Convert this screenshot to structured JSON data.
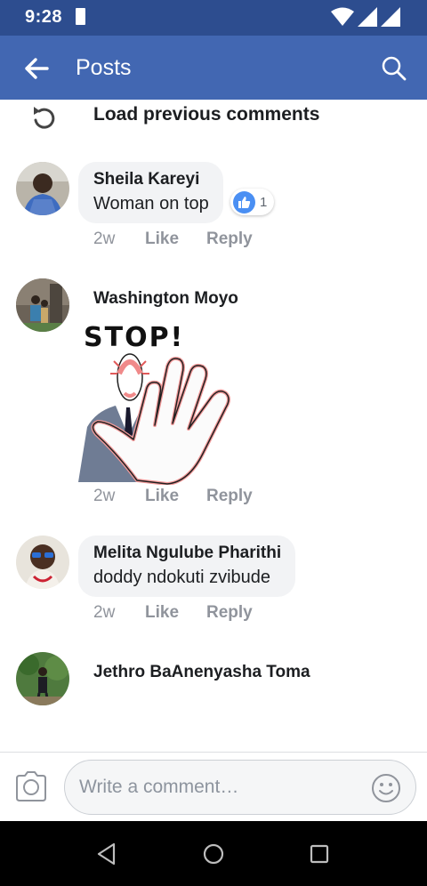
{
  "status_bar": {
    "time": "9:28"
  },
  "header": {
    "title": "Posts"
  },
  "load_previous": {
    "label": "Load previous comments"
  },
  "comments": [
    {
      "author": "Sheila Kareyi",
      "text": "Woman on top",
      "reaction_count": "1",
      "time": "2w",
      "like": "Like",
      "reply": "Reply"
    },
    {
      "author": "Washington Moyo",
      "sticker_text": "STOP!",
      "time": "2w",
      "like": "Like",
      "reply": "Reply"
    },
    {
      "author": "Melita Ngulube Pharithi",
      "text": "doddy ndokuti zvibude",
      "time": "2w",
      "like": "Like",
      "reply": "Reply"
    },
    {
      "author": "Jethro BaAnenyasha Toma"
    }
  ],
  "composer": {
    "placeholder": "Write a comment…"
  },
  "colors": {
    "header": "#4267b2",
    "status_bar": "#2d4d8f",
    "bubble": "#f2f3f5",
    "like_blue": "#4a8ff3"
  }
}
